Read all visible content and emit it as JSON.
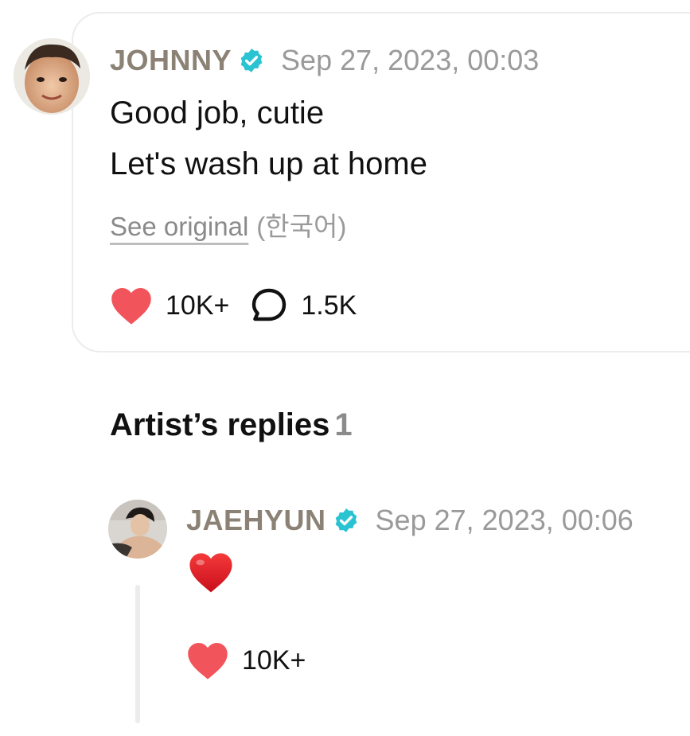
{
  "post": {
    "author": "JOHNNY",
    "timestamp": "Sep 27, 2023, 00:03",
    "lines": [
      "Good job, cutie",
      "Let's wash up at home"
    ],
    "see_original": "See original",
    "language": "(한국어)",
    "likes": "10K+",
    "comments": "1.5K",
    "avatar_icon": "profile-photo",
    "verified_icon": "verified-badge-icon"
  },
  "replies_section": {
    "title": "Artist’s replies",
    "count": "1"
  },
  "reply": {
    "author": "JAEHYUN",
    "timestamp": "Sep 27, 2023, 00:06",
    "content_emoji": "red-heart-emoji",
    "likes": "10K+",
    "avatar_icon": "profile-photo",
    "verified_icon": "verified-badge-icon"
  },
  "colors": {
    "author_name": "#8b8275",
    "timestamp": "#9a9a9a",
    "verified_badge": "#29c3d2",
    "heart": "#f2545b",
    "card_border": "#ececec"
  }
}
